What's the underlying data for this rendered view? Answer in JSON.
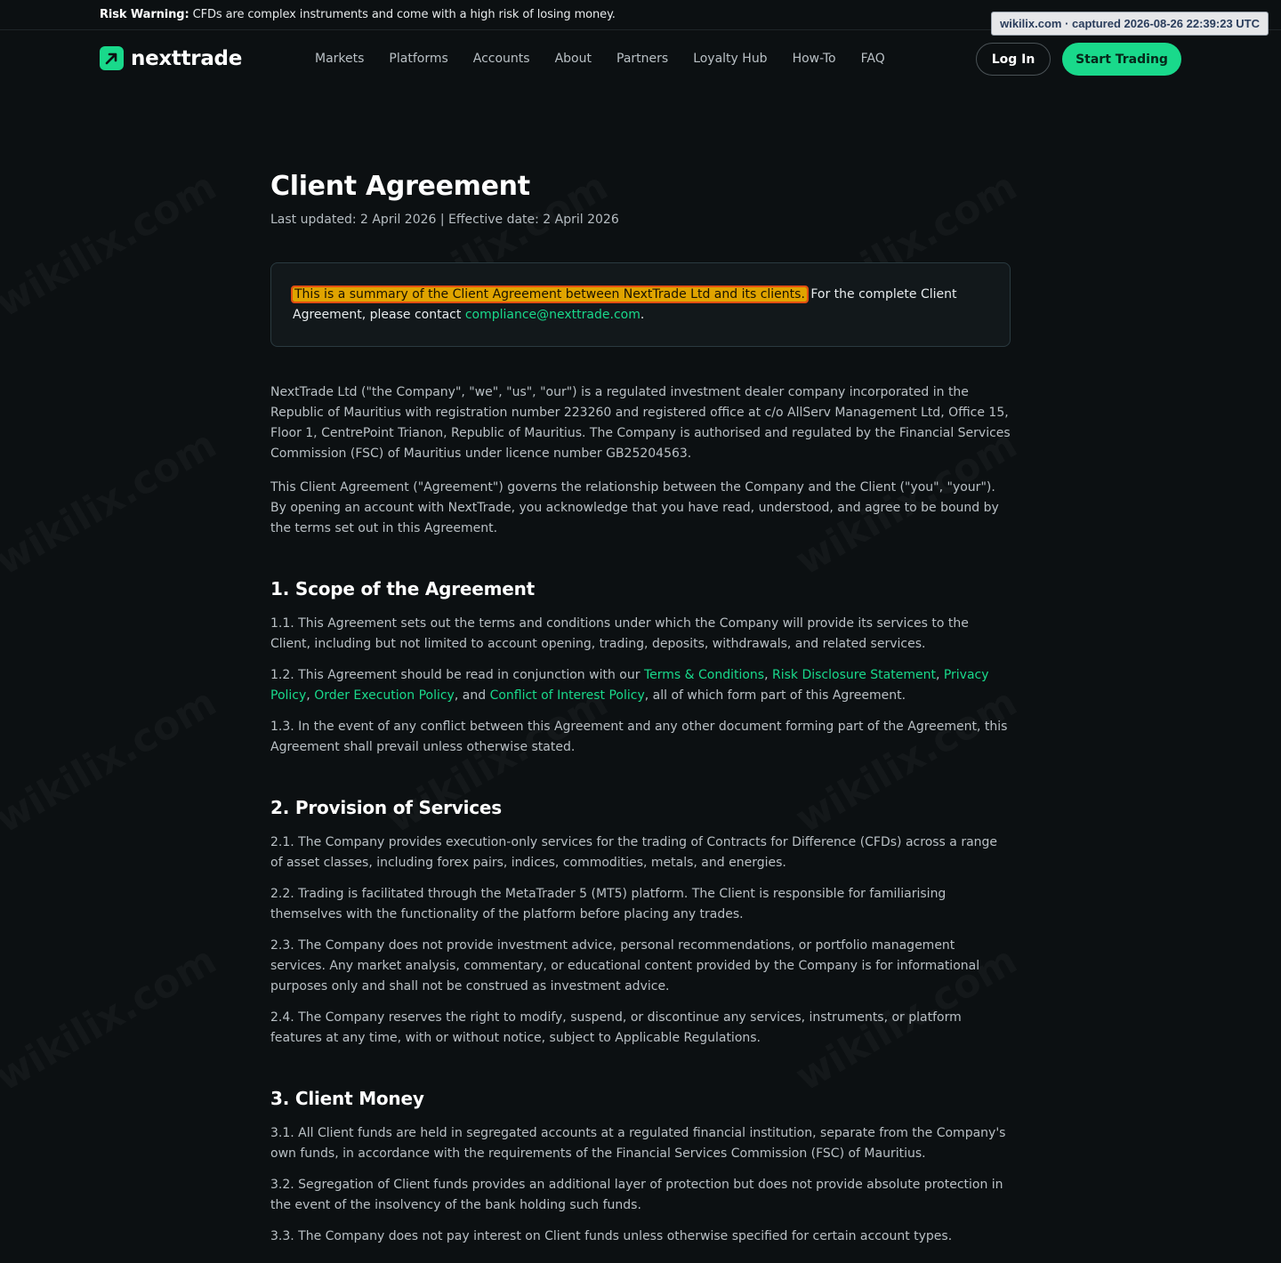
{
  "risk_warning": {
    "label": "Risk Warning:",
    "text": "CFDs are complex instruments and come with a high risk of losing money."
  },
  "capture_badge": "wikilix.com · captured 2026-08-26 22:39:23 UTC",
  "watermark_text": "wikilix.com",
  "brand": {
    "name": "nexttrade",
    "accent": "#19d98b",
    "logo_icon": "arrow-up-right-icon"
  },
  "nav": {
    "items": [
      "Markets",
      "Platforms",
      "Accounts",
      "About",
      "Partners",
      "Loyalty Hub",
      "How-To",
      "FAQ"
    ]
  },
  "header_actions": {
    "login": "Log In",
    "start": "Start Trading"
  },
  "page": {
    "title": "Client Agreement",
    "updated": "Last updated: 2 April 2026 | Effective date: 2 April 2026"
  },
  "summary": {
    "highlight": "This is a summary of the Client Agreement between NextTrade Ltd and its clients.",
    "rest": " For the complete Client Agreement, please contact ",
    "email": "compliance@nexttrade.com",
    "end": "."
  },
  "intro": [
    "NextTrade Ltd (\"the Company\", \"we\", \"us\", \"our\") is a regulated investment dealer company incorporated in the Republic of Mauritius with registration number 223260 and registered office at c/o AllServ Management Ltd, Office 15, Floor 1, CentrePoint Trianon, Republic of Mauritius. The Company is authorised and regulated by the Financial Services Commission (FSC) of Mauritius under licence number GB25204563.",
    "This Client Agreement (\"Agreement\") governs the relationship between the Company and the Client (\"you\", \"your\"). By opening an account with NextTrade, you acknowledge that you have read, understood, and agree to be bound by the terms set out in this Agreement."
  ],
  "section1": {
    "title": "1. Scope of the Agreement",
    "p1": "1.1. This Agreement sets out the terms and conditions under which the Company will provide its services to the Client, including but not limited to account opening, trading, deposits, withdrawals, and related services.",
    "p2_prefix": "1.2. This Agreement should be read in conjunction with our ",
    "links": [
      "Terms & Conditions",
      "Risk Disclosure Statement",
      "Privacy Policy",
      "Order Execution Policy",
      "Conflict of Interest Policy"
    ],
    "sep1": ", ",
    "sep2": ", ",
    "sep3": ", ",
    "sep4": ", and ",
    "p2_suffix": ", all of which form part of this Agreement.",
    "p3": "1.3. In the event of any conflict between this Agreement and any other document forming part of the Agreement, this Agreement shall prevail unless otherwise stated."
  },
  "section2": {
    "title": "2. Provision of Services",
    "paragraphs": [
      "2.1. The Company provides execution-only services for the trading of Contracts for Difference (CFDs) across a range of asset classes, including forex pairs, indices, commodities, metals, and energies.",
      "2.2. Trading is facilitated through the MetaTrader 5 (MT5) platform. The Client is responsible for familiarising themselves with the functionality of the platform before placing any trades.",
      "2.3. The Company does not provide investment advice, personal recommendations, or portfolio management services. Any market analysis, commentary, or educational content provided by the Company is for informational purposes only and shall not be construed as investment advice.",
      "2.4. The Company reserves the right to modify, suspend, or discontinue any services, instruments, or platform features at any time, with or without notice, subject to Applicable Regulations."
    ]
  },
  "section3": {
    "title": "3. Client Money",
    "paragraphs": [
      "3.1. All Client funds are held in segregated accounts at a regulated financial institution, separate from the Company's own funds, in accordance with the requirements of the Financial Services Commission (FSC) of Mauritius.",
      "3.2. Segregation of Client funds provides an additional layer of protection but does not provide absolute protection in the event of the insolvency of the bank holding such funds.",
      "3.3. The Company does not pay interest on Client funds unless otherwise specified for certain account types."
    ]
  }
}
